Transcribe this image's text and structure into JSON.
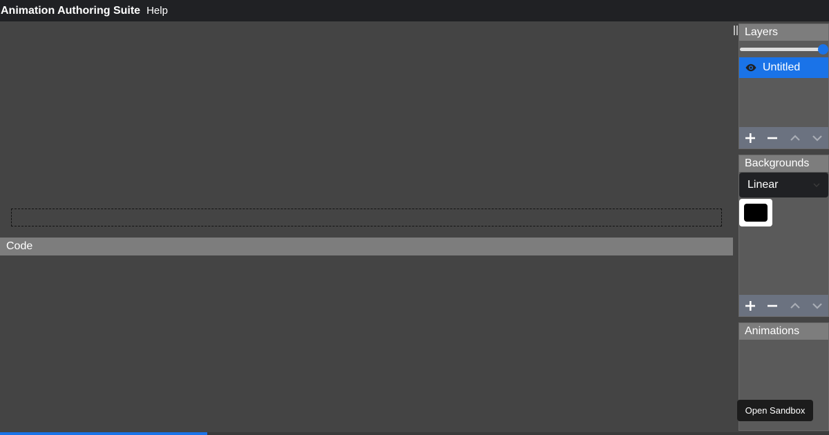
{
  "menubar": {
    "app_title": "Animation Authoring Suite",
    "help_label": "Help"
  },
  "code": {
    "header": "Code"
  },
  "progress": {
    "value_percent": 25
  },
  "layers": {
    "header": "Layers",
    "slider_value_percent": 100,
    "items": [
      {
        "label": "Untitled",
        "selected": true,
        "visible_icon": "eye-icon"
      }
    ],
    "toolbar": [
      "plus-icon",
      "minus-icon",
      "chevron-up-icon",
      "chevron-down-icon"
    ]
  },
  "backgrounds": {
    "header": "Backgrounds",
    "type_select": {
      "value": "Linear"
    },
    "color": "#000000",
    "toolbar": [
      "plus-icon",
      "minus-icon",
      "chevron-up-icon",
      "chevron-down-icon"
    ]
  },
  "animations": {
    "header": "Animations"
  },
  "tooltip": {
    "text": "Open Sandbox"
  },
  "colors": {
    "accent": "#1a73e8",
    "menubar_bg": "#202124",
    "panel_header_bg": "#7d7d7d"
  }
}
